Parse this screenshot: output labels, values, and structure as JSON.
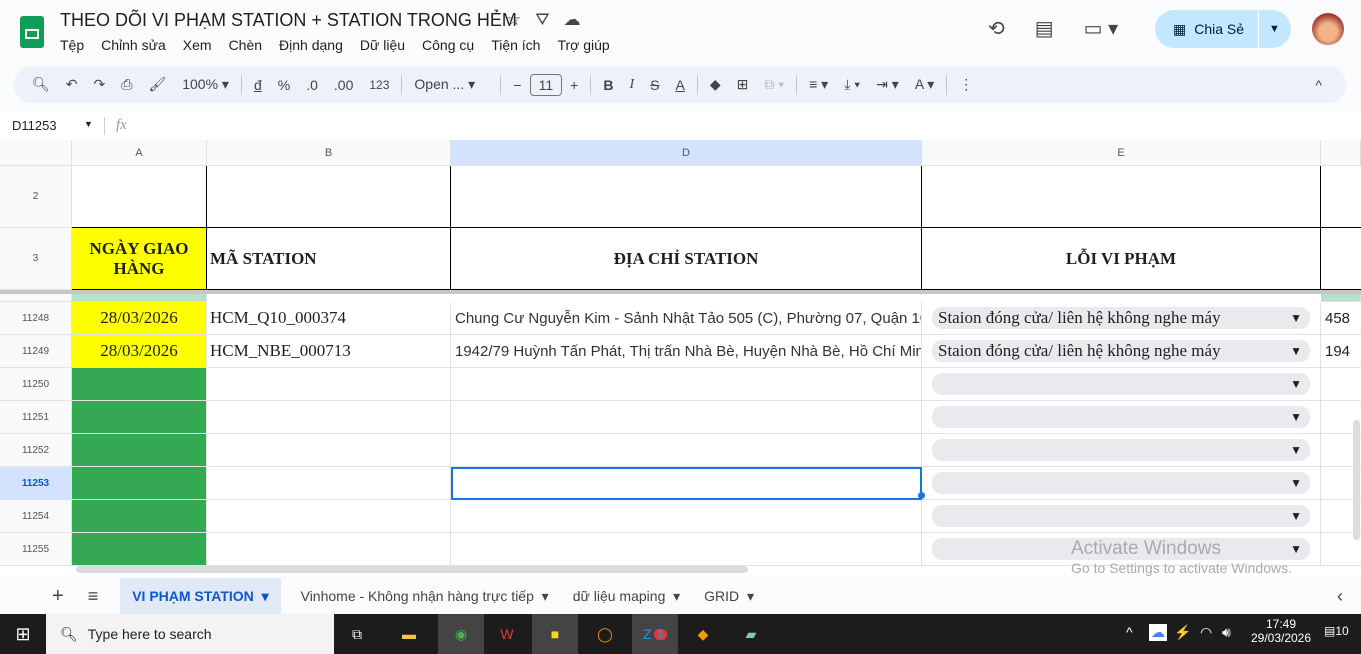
{
  "doc": {
    "title": "THEO DÕI VI PHẠM STATION + STATION TRONG HẺM",
    "menu": [
      "Tệp",
      "Chỉnh sửa",
      "Xem",
      "Chèn",
      "Định dạng",
      "Dữ liệu",
      "Công cụ",
      "Tiện ích",
      "Trợ giúp"
    ]
  },
  "header": {
    "share_label": "Chia Sẻ"
  },
  "toolbar": {
    "zoom": "100%",
    "currency": "đ",
    "percent": "%",
    "dec_decrease": ".0",
    "dec_increase": ".00",
    "format_123": "123",
    "font": "Open ...",
    "font_size": "11"
  },
  "formula": {
    "cell_ref": "D11253",
    "fx": "fx",
    "value": ""
  },
  "columns": [
    "A",
    "B",
    "D",
    "E"
  ],
  "headers": {
    "row2": "2",
    "row3": "3",
    "a": "NGÀY GIAO HÀNG",
    "b": "MÃ STATION",
    "d": "ĐỊA CHỈ STATION",
    "e": "LỖI VI PHẠM"
  },
  "rows": [
    {
      "num": "11248",
      "date": "28/03/2026",
      "code": "HCM_Q10_000374",
      "address": "Chung Cư Nguyễn Kim - Sảnh Nhật Tảo 505 (C), Phường 07, Quận 10,",
      "error": "Staion đóng cửa/ liên hệ không nghe máy",
      "next": "458"
    },
    {
      "num": "11249",
      "date": "28/03/2026",
      "code": "HCM_NBE_000713",
      "address": "1942/79 Huỳnh Tấn Phát, Thị trấn Nhà Bè, Huyện Nhà Bè, Hồ Chí Min",
      "error": "Staion đóng cửa/ liên hệ không nghe máy",
      "next": "194"
    },
    {
      "num": "11250",
      "date": "",
      "code": "",
      "address": "",
      "error": "",
      "next": ""
    },
    {
      "num": "11251",
      "date": "",
      "code": "",
      "address": "",
      "error": "",
      "next": ""
    },
    {
      "num": "11252",
      "date": "",
      "code": "",
      "address": "",
      "error": "",
      "next": ""
    },
    {
      "num": "11253",
      "date": "",
      "code": "",
      "address": "",
      "error": "",
      "next": ""
    },
    {
      "num": "11254",
      "date": "",
      "code": "",
      "address": "",
      "error": "",
      "next": ""
    },
    {
      "num": "11255",
      "date": "",
      "code": "",
      "address": "",
      "error": "",
      "next": ""
    }
  ],
  "watermark": {
    "line1": "Activate Windows",
    "line2": "Go to Settings to activate Windows."
  },
  "sheets": [
    "VI PHẠM STATION",
    "Vinhome - Không nhận hàng trực tiếp",
    "dữ liệu maping",
    "GRID"
  ],
  "taskbar": {
    "search": "Type here to search",
    "time": "17:49",
    "date": "29/03/2026",
    "notifications": "10",
    "zalo_badge": "1"
  },
  "colors": {
    "green": "#34a853",
    "yellow": "#ffff00",
    "accent": "#1a73e8",
    "share_bg": "#c2e7ff"
  }
}
